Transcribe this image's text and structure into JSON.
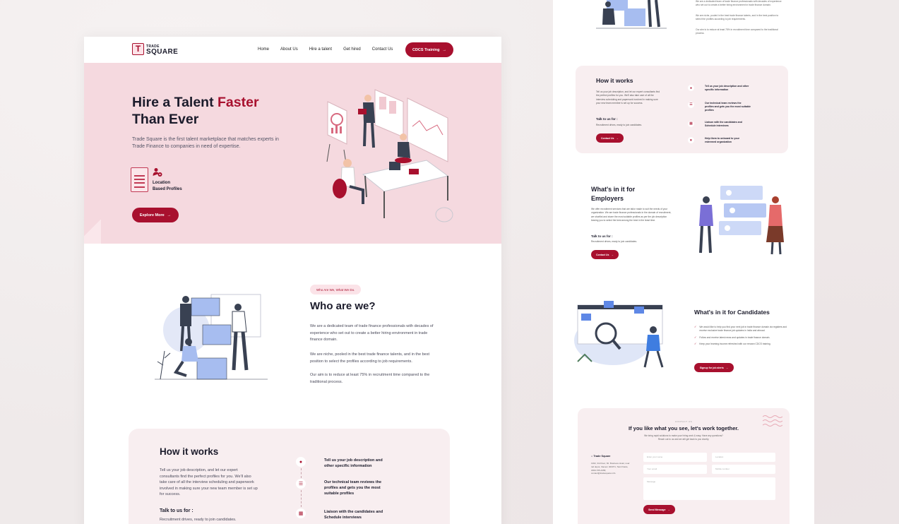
{
  "colors": {
    "brand": "#a8102e",
    "hero_bg": "#f5d9df",
    "card_bg": "#f8eef0"
  },
  "logo": {
    "letter": "T",
    "small": "TRADE",
    "big": "SQUARE"
  },
  "nav": {
    "links": [
      "Home",
      "About Us",
      "Hire a talent",
      "Get hired",
      "Contact Us"
    ],
    "cta": "CDCS Training"
  },
  "hero": {
    "title_part1": "Hire a Talent ",
    "title_accent": "Faster",
    "title_part2": "Than Ever",
    "description": "Trade Square is the first talent marketplace that matches experts in Trade Finance to companies in need of expertise.",
    "feature_line1": "Location",
    "feature_line2": "Based Profiles",
    "button": "Explore More"
  },
  "who": {
    "label": "Who Are We, What We Do.",
    "title": "Who are we?",
    "p1": "We are a dedicated team of trade finance professionals with decades of experience who set out to create a better hiring environment in trade finance domain.",
    "p2": "We are niche, pooled in the best trade finance talents, and in the best position to select the profiles according to job requirements.",
    "p3": "Our aim is to reduce at least 75% in recruitment time compared to the traditional process."
  },
  "how": {
    "title": "How it works",
    "description": "Tell us your job description, and let our expert consultants find the perfect profiles for you.  We'll also take care of all the interview scheduling and paperwork involved in making sure your new team member is set up for success.",
    "talk_title": "Talk to us for :",
    "talk_sub": "Recruitment drives, ready to join candidates.",
    "steps": [
      {
        "icon": "user-pin-icon",
        "text": "Tell us your job description and other specific information"
      },
      {
        "icon": "list-icon",
        "text": "Our technical team reviews the profiles and gets you the most suitable profiles"
      },
      {
        "icon": "calendar-icon",
        "text": "Liaison with the candidates and Schedule interviews"
      },
      {
        "icon": "handshake-icon",
        "text": "Help them to onboard to your esteemed organization"
      }
    ],
    "button": "Contact Us"
  },
  "employers": {
    "title_line1": "What's in it for",
    "title_line2": "Employers",
    "description": "We offer recruitment services that are tailor made to suit the needs of your organization. We are trade finance professionals in the domain of recruitment, we shortlist and share the most suitable profiles as per the job description leaving you to select the best among the best in the least time.",
    "talk_title": "Talk to us for :",
    "talk_sub": "Recruitment drives, ready to join candidates.",
    "button": "Contact Us"
  },
  "candidates": {
    "title": "What's in it for Candidates",
    "items": [
      "We would like to help you find your next job in trade finance domain via registers and receive exclusive trade finance job updates in India and abroad.",
      "Follow and receive latest news and updates in trade finance domain.",
      "Keep your learning income refreshed with our renown CDCS training."
    ],
    "button": "Signup for job alerts"
  },
  "contact": {
    "overline": "CONTACT US",
    "title": "If you like what you see, let's work together.",
    "subtitle_line1": "We bring rapid solutions to make your hiring work & easy. Have any questions?",
    "subtitle_line2": "Reach out to us and we will get back to you shortly.",
    "company": "Trade Square",
    "address": "1302, 3rd Floor, Mr. Business Hotel, near rail depot, thanem 400071, Tamil Nadu, 1800-765-4358, contact@tradesquare.info",
    "placeholders": {
      "name": "Enter your name",
      "location": "Location",
      "email": "Your email",
      "phone": "Mobile number",
      "message": "Message"
    },
    "button": "Send Message"
  }
}
